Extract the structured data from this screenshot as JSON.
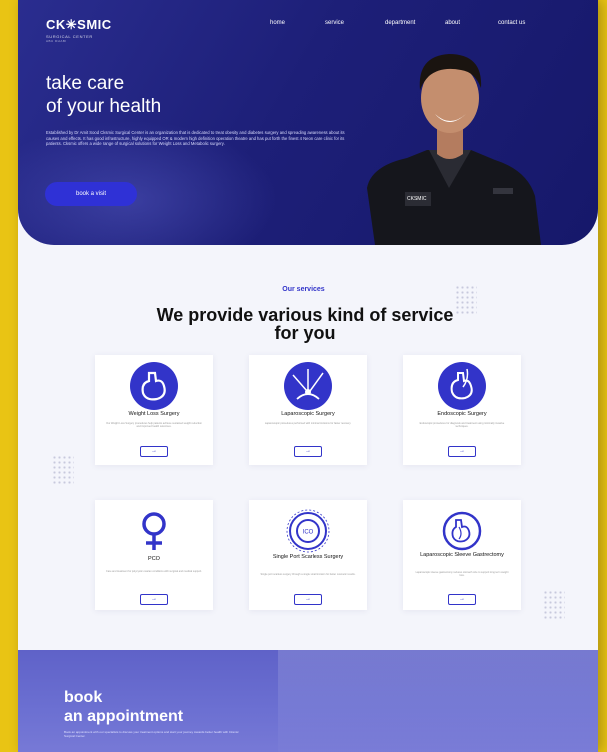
{
  "brand": {
    "name": "CK✳SMIC",
    "tagline": "SURGICAL CENTER",
    "subtagline": "ABU DHABI"
  },
  "nav": [
    "home",
    "service",
    "department",
    "about",
    "contact us"
  ],
  "hero": {
    "title_line1": "take care",
    "title_line2": "of your health",
    "description": "Established by Dr Amit Sood Cksmic Surgical Center is an organization that is dedicated to treat obesity and diabetes surgery and spreading awareness about its causes and effects. It has good infrastructure, highly equipped OR & modern high definition operation theatre and has put forth the finest 4 Neon care clinic for its patients. Cksmic offers a wide range of surgical solutions for Weight Loss and Metabolic surgery.",
    "cta": "book a visit",
    "badge": "CKSMIC"
  },
  "services": {
    "tag": "Our services",
    "title": "We provide various kind of service for you",
    "cards": [
      {
        "name": "Weight Loss Surgery",
        "icon": "stomach-icon",
        "desc": "Our Weight Loss Surgery procedures help patients achieve sustained weight reduction and improved health outcomes."
      },
      {
        "name": "Laparoscopic Surgery",
        "icon": "laparoscopy-icon",
        "desc": "Laparoscopic procedures performed with minimal incisions for faster recovery."
      },
      {
        "name": "Endoscopic Surgery",
        "icon": "endoscopy-icon",
        "desc": "Endoscopic procedures for diagnosis and treatment using minimally invasive techniques."
      },
      {
        "name": "PCO",
        "icon": "female-symbol-icon",
        "desc": "Care and treatment for polycystic ovarian conditions with surgical and medical support."
      },
      {
        "name": "Single Port Scarless Surgery",
        "icon": "single-port-icon",
        "desc": "Single port scarless surgery through a single small incision for better cosmetic results."
      },
      {
        "name": "Laparoscopic Sleeve Gastrectomy",
        "icon": "sleeve-gastrectomy-icon",
        "desc": "Laparoscopic sleeve gastrectomy reduces stomach size to support long term weight loss."
      }
    ],
    "more_label": "→"
  },
  "booking": {
    "title_line1": "book",
    "title_line2": "an appointment",
    "description": "Book an appointment with our specialists to discuss your treatment options and start your journey towards better health with Cksmic Surgical Center."
  },
  "colors": {
    "accent": "#3234c9",
    "hero_bg": "#1d1f78",
    "frame": "#e9c414"
  }
}
